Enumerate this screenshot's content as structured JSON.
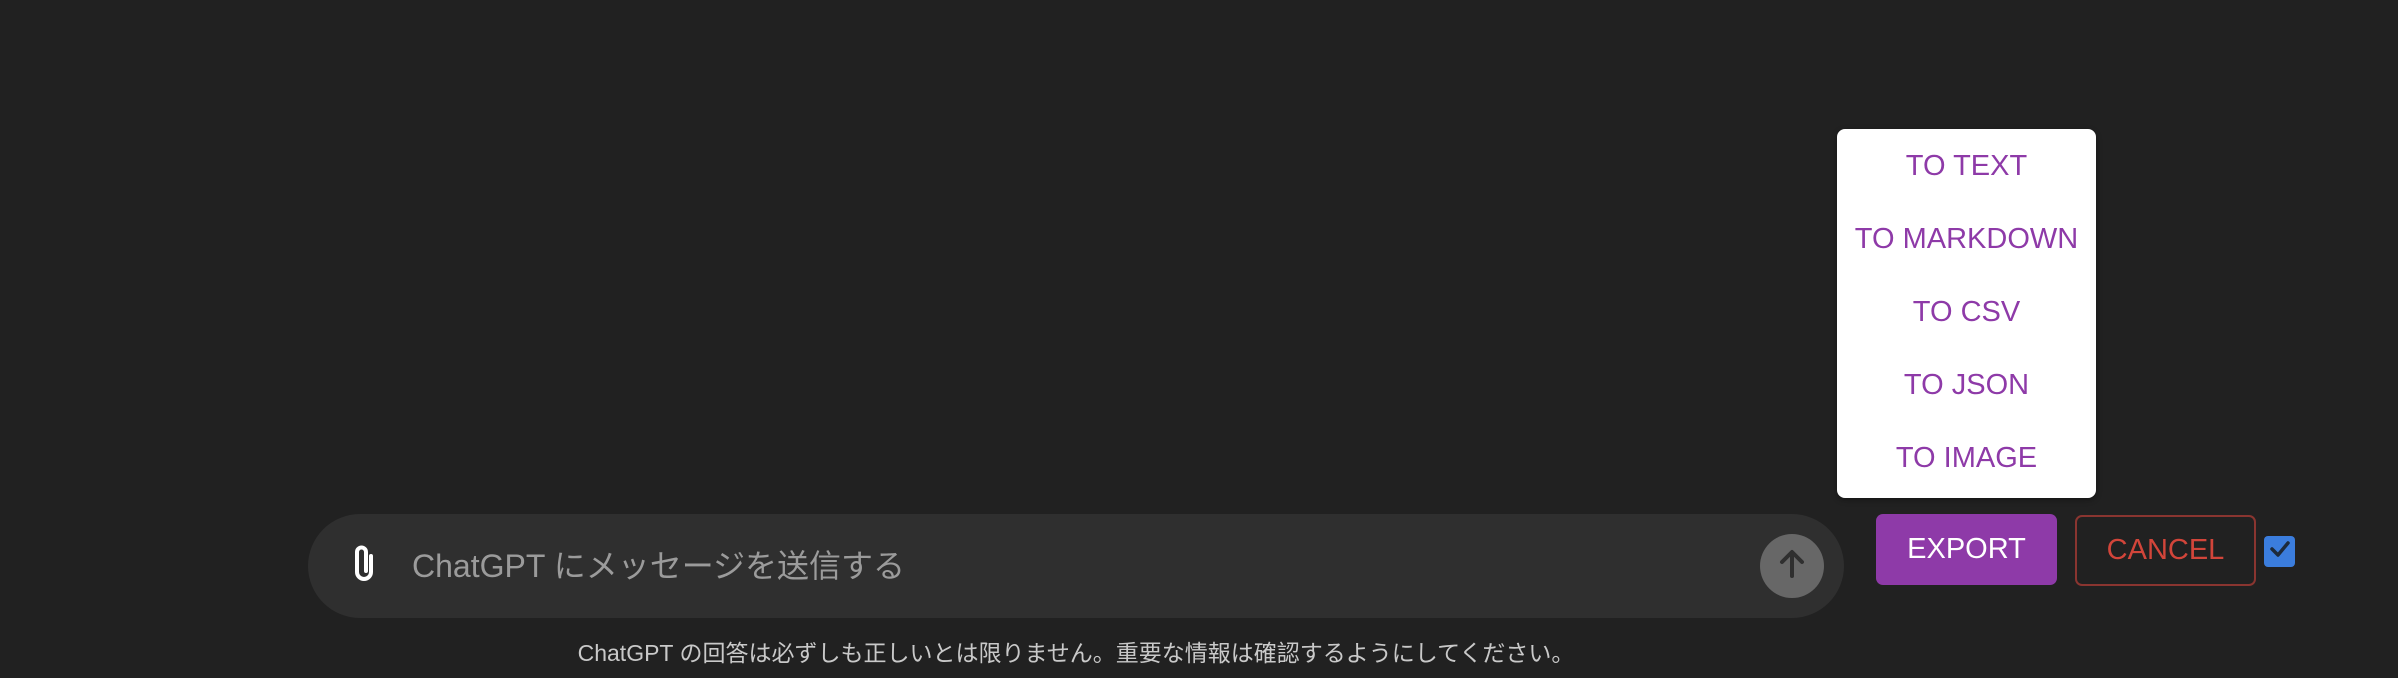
{
  "export_menu": {
    "items": [
      {
        "label": "TO TEXT"
      },
      {
        "label": "TO MARKDOWN"
      },
      {
        "label": "TO CSV"
      },
      {
        "label": "TO JSON"
      },
      {
        "label": "TO IMAGE"
      }
    ]
  },
  "composer": {
    "attach_icon": "paperclip-icon",
    "placeholder": "ChatGPT にメッセージを送信する",
    "value": "",
    "send_icon": "arrow-up-icon"
  },
  "disclaimer": "ChatGPT の回答は必ずしも正しいとは限りません。重要な情報は確認するようにしてください。",
  "actions": {
    "export_label": "EXPORT",
    "cancel_label": "CANCEL",
    "select_checked": true
  },
  "colors": {
    "background": "#212121",
    "accent_purple": "#8e3aa8",
    "cancel_red": "#d2453a",
    "checkbox_blue": "#3b7ddd"
  }
}
